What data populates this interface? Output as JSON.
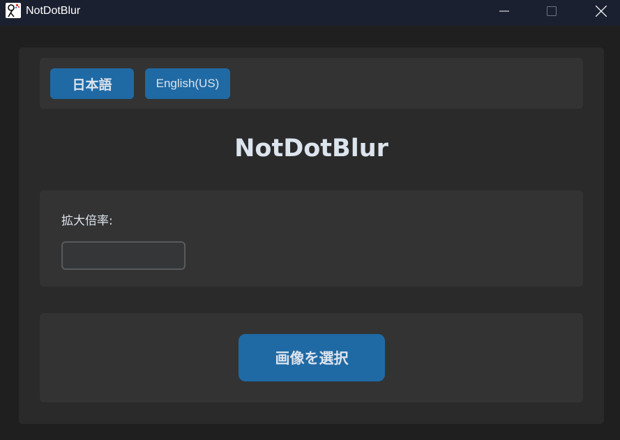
{
  "window": {
    "title": "NotDotBlur",
    "app_icon": "app-logo-icon",
    "controls": {
      "minimize_icon": "minimize-icon",
      "maximize_icon": "maximize-icon",
      "close_icon": "close-icon"
    }
  },
  "language": {
    "japanese_label": "日本語",
    "english_label": "English(US)"
  },
  "main": {
    "title": "NotDotBlur",
    "scale_label": "拡大倍率:",
    "scale_value": "",
    "select_image_label": "画像を選択"
  },
  "colors": {
    "accent": "#1f6aa5",
    "titlebar": "#1b2030",
    "panel": "#333333",
    "card": "#2a2a2a",
    "background": "#1f1f1f",
    "text": "#dce4ee"
  }
}
